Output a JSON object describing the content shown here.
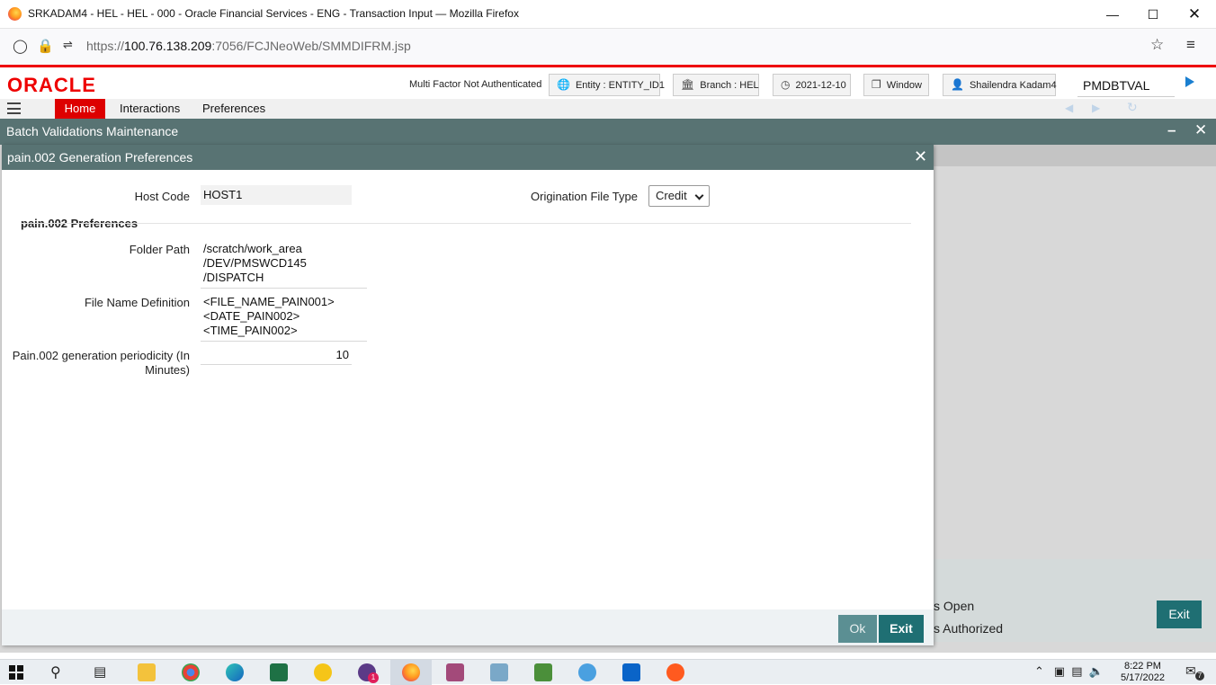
{
  "browser": {
    "window_title": "SRKADAM4 - HEL - HEL - 000 - Oracle Financial Services - ENG - Transaction Input — Mozilla Firefox",
    "url_prefix": "https://",
    "url_host": "100.76.138.209",
    "url_rest": ":7056/FCJNeoWeb/SMMDIFRM.jsp"
  },
  "header": {
    "logo": "ORACLE",
    "mfa_status": "Multi Factor Not Authenticated",
    "entity": "Entity : ENTITY_ID1",
    "branch": "Branch : HEL",
    "date": "2021-12-10",
    "window": "Window",
    "user": "Shailendra Kadam4",
    "function_id": "PMDBTVAL"
  },
  "menu": {
    "items": [
      "Home",
      "Interactions",
      "Preferences"
    ]
  },
  "main_window": {
    "title": "Batch Validations Maintenance",
    "footer_status": [
      "s Open",
      "s Authorized"
    ],
    "exit_label": "Exit"
  },
  "dialog": {
    "title": "pain.002 Generation Preferences",
    "host_code_label": "Host Code",
    "host_code_value": "HOST1",
    "orig_file_type_label": "Origination File Type",
    "orig_file_type_value": "Credit",
    "section_title": "pain.002 Preferences",
    "folder_path_label": "Folder Path",
    "folder_path_lines": [
      "/scratch/work_area",
      "/DEV/PMSWCD145",
      "/DISPATCH"
    ],
    "file_name_label": "File Name Definition",
    "file_name_lines": [
      "<FILE_NAME_PAIN001>",
      "<DATE_PAIN002>",
      "<TIME_PAIN002>"
    ],
    "periodicity_label_1": "Pain.002 generation periodicity (In",
    "periodicity_label_2": "Minutes)",
    "periodicity_value": "10",
    "ok_label": "Ok",
    "exit_label": "Exit"
  },
  "taskbar": {
    "time": "8:22 PM",
    "date": "5/17/2022",
    "notification_count": "7",
    "badge_count": "1"
  },
  "colors": {
    "oracle_red": "#e00000",
    "header_teal": "#587373",
    "button_teal": "#1f6f73"
  }
}
